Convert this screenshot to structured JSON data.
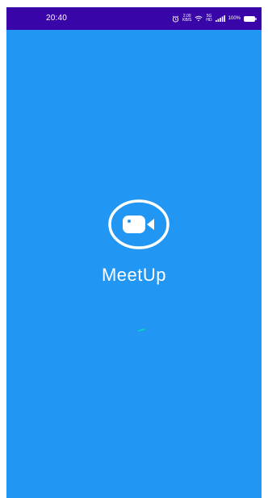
{
  "status_bar": {
    "time": "20:40",
    "alarm_icon": "alarm-icon",
    "network_speed": "2.00",
    "network_speed_unit": "KB/S",
    "wifi_icon": "wifi-icon",
    "network_type": "5G",
    "network_type_sub": "HD",
    "signal_icon": "signal-icon",
    "battery_level": "100%",
    "battery_icon": "battery-icon"
  },
  "splash": {
    "app_name": "MeetUp",
    "logo_icon": "video-camera-icon",
    "loader_icon": "loading-spinner-icon"
  },
  "colors": {
    "background": "#2196f3",
    "status_bar": "#3a05a8",
    "accent_spinner": "#00e5b0",
    "text": "#ffffff"
  }
}
